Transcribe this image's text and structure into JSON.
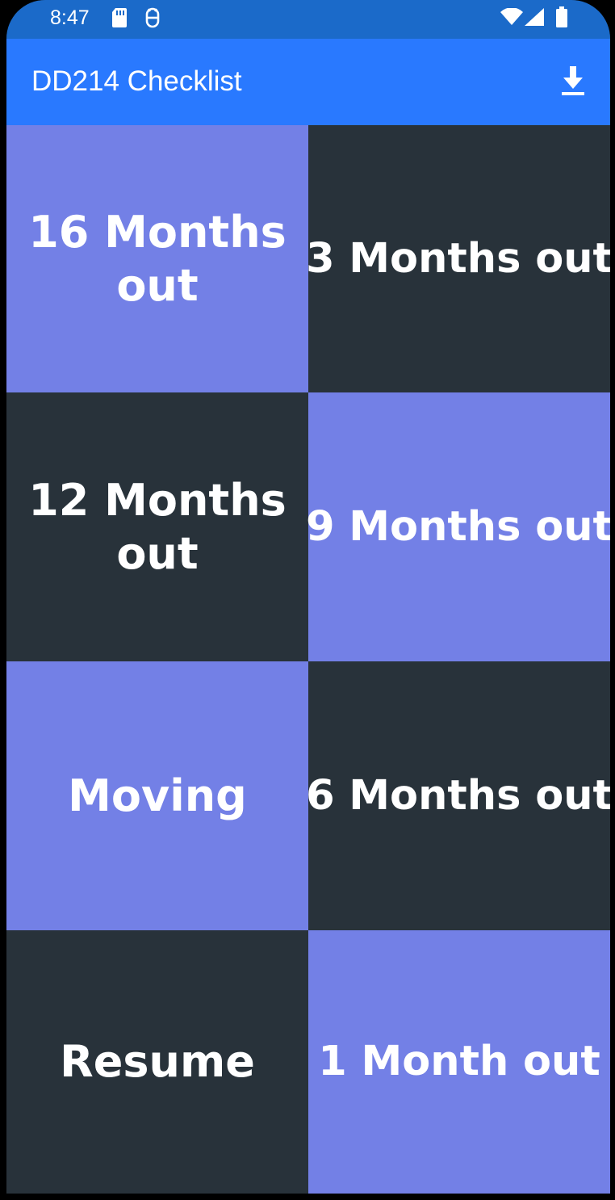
{
  "status_bar": {
    "time": "8:47",
    "icons": [
      "sd-card-icon",
      "android-debug-icon",
      "wifi-icon",
      "signal-icon",
      "battery-icon"
    ]
  },
  "app_bar": {
    "title": "DD214 Checklist",
    "action_icon": "download-icon"
  },
  "colors": {
    "status_bar": "#1b6ac9",
    "app_bar": "#2979ff",
    "tile_light": "#7380e6",
    "tile_dark": "#28323a"
  },
  "tiles": [
    {
      "label": "16 Months out",
      "style": "light"
    },
    {
      "label": "3 Months out",
      "style": "dark"
    },
    {
      "label": "12 Months out",
      "style": "dark"
    },
    {
      "label": "9 Months out",
      "style": "light"
    },
    {
      "label": "Moving",
      "style": "light"
    },
    {
      "label": "6 Months out",
      "style": "dark"
    },
    {
      "label": "Resume",
      "style": "dark"
    },
    {
      "label": "1 Month out",
      "style": "light"
    }
  ]
}
